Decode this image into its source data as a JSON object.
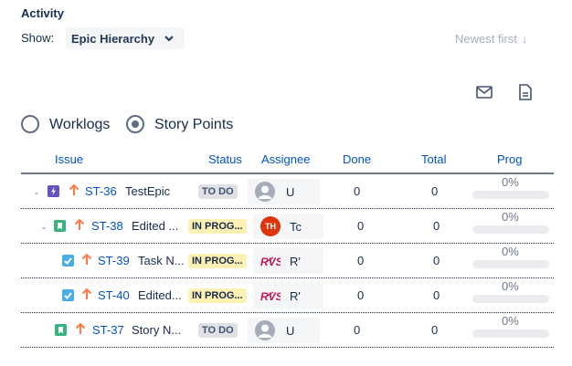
{
  "activity": {
    "title": "Activity"
  },
  "show": {
    "label": "Show:",
    "selected": "Epic Hierarchy"
  },
  "sort": {
    "label": "Newest first"
  },
  "icons": {
    "mail": "mail-icon",
    "document": "document-icon"
  },
  "radio": {
    "options": [
      {
        "label": "Worklogs",
        "checked": false
      },
      {
        "label": "Story Points",
        "checked": true
      }
    ]
  },
  "table": {
    "headers": {
      "issue": "Issue",
      "status": "Status",
      "assignee": "Assignee",
      "done": "Done",
      "total": "Total",
      "progress": "Prog"
    },
    "rows": [
      {
        "toggle": "-",
        "type": "epic",
        "key": "ST-36",
        "summary": "TestEpic",
        "status": "TO DO",
        "assignee": "U",
        "avatar": "default",
        "done": "0",
        "total": "0",
        "progress": "0%"
      },
      {
        "toggle": "-",
        "type": "story",
        "key": "ST-38",
        "summary": "Edited ...",
        "status": "IN PROG...",
        "assignee": "Tc",
        "avatar_text": "TH",
        "avatar": "initials",
        "done": "0",
        "total": "0",
        "progress": "0%"
      },
      {
        "toggle": "",
        "type": "task",
        "key": "ST-39",
        "summary": "Task N...",
        "status": "IN PROG...",
        "assignee": "R'",
        "avatar": "rvs",
        "done": "0",
        "total": "0",
        "progress": "0%"
      },
      {
        "toggle": "",
        "type": "task",
        "key": "ST-40",
        "summary": "Edited...",
        "status": "IN PROG...",
        "assignee": "R'",
        "avatar": "rvs",
        "done": "0",
        "total": "0",
        "progress": "0%"
      },
      {
        "toggle": "",
        "type": "story",
        "key": "ST-37",
        "summary": "Story N...",
        "status": "TO DO",
        "assignee": "U",
        "avatar": "default",
        "done": "0",
        "total": "0",
        "progress": "0%"
      }
    ]
  },
  "colors": {
    "link": "#0052cc",
    "epic": "#6554c0",
    "story": "#36b37e",
    "task": "#4bade8",
    "priority": "#ff7a45",
    "avatar_red": "#de350b",
    "rvs": "#c2185b"
  }
}
